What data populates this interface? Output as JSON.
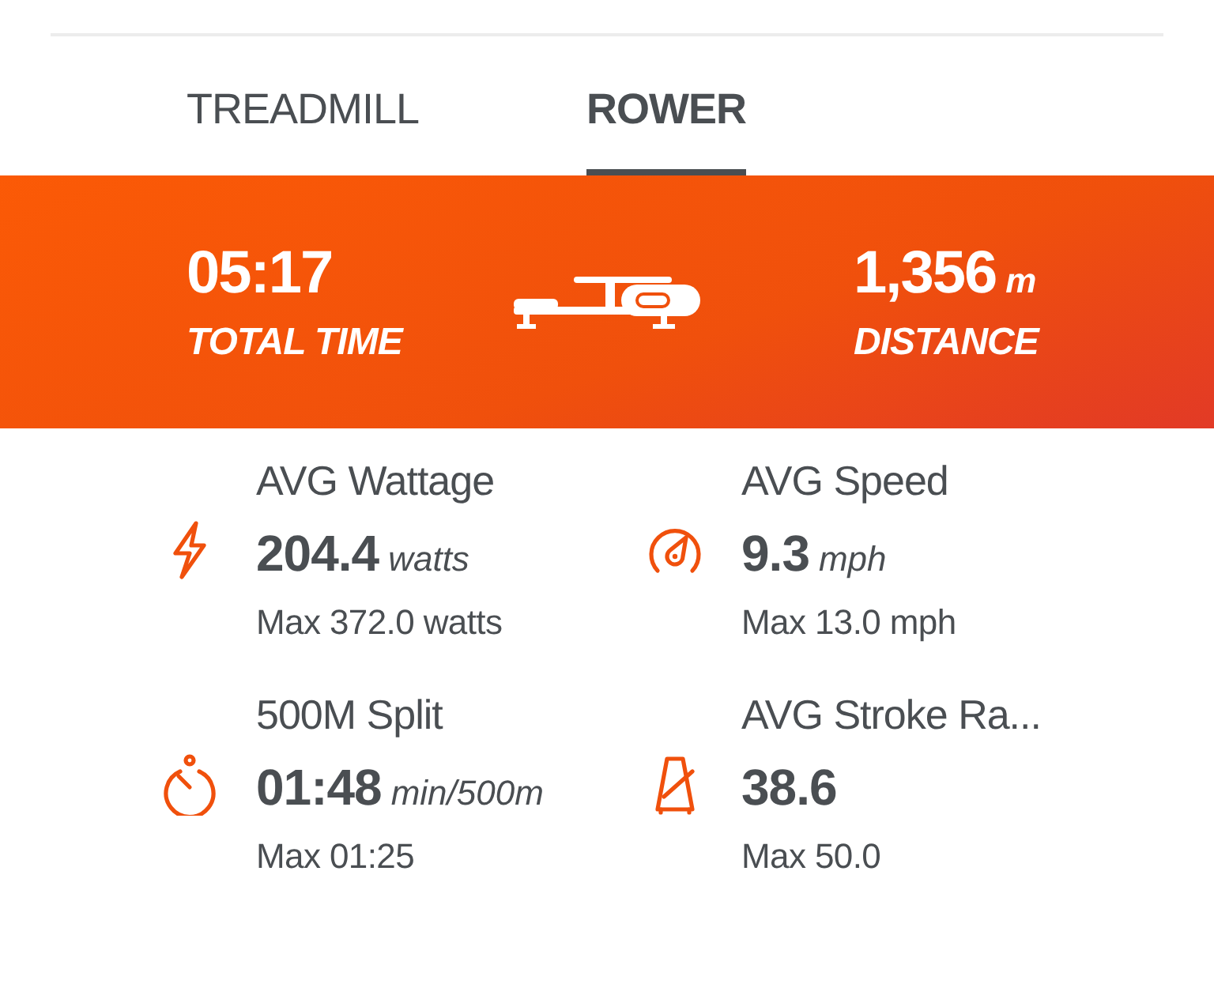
{
  "tabs": [
    {
      "label": "TREADMILL",
      "selected": false
    },
    {
      "label": "ROWER",
      "selected": true
    }
  ],
  "summary": {
    "time": {
      "value": "05:17",
      "label": "TOTAL TIME"
    },
    "distance": {
      "value": "1,356",
      "unit": "m",
      "label": "DISTANCE"
    }
  },
  "metrics": [
    {
      "kind": "power",
      "title": "AVG Wattage",
      "value": "204.4",
      "unit": "watts",
      "max": "Max 372.0 watts"
    },
    {
      "kind": "speed",
      "title": "AVG Speed",
      "value": "9.3",
      "unit": "mph",
      "max": "Max 13.0 mph"
    },
    {
      "kind": "split",
      "title": "500M Split",
      "value": "01:48",
      "unit": "min/500m",
      "max": "Max 01:25"
    },
    {
      "kind": "stroke",
      "title": "AVG Stroke Ra...",
      "value": "38.6",
      "max": "Max 50.0"
    }
  ]
}
